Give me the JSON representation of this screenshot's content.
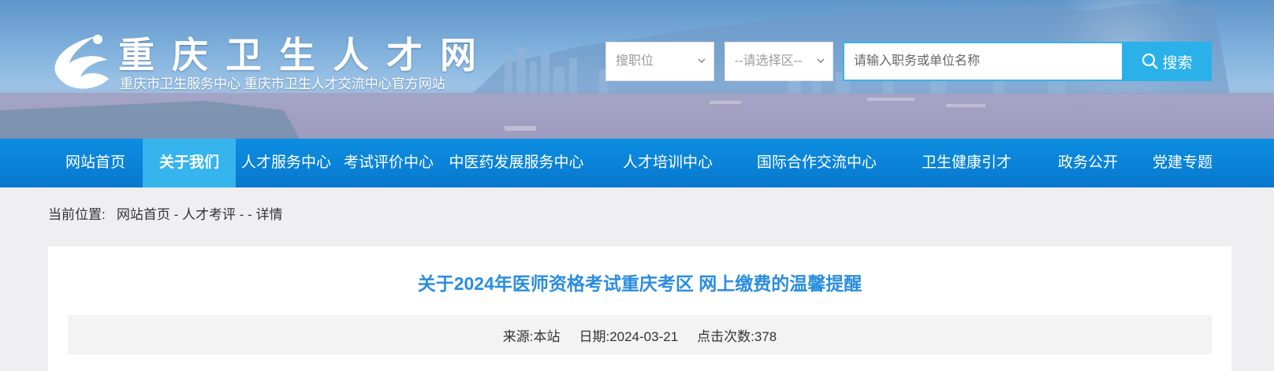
{
  "header": {
    "logo_title": "重庆卫生人才网",
    "logo_subtitle": "重庆市卫生服务中心 重庆市卫生人才交流中心官方网站",
    "job_select": "搜职位",
    "area_select": "--请选择区--",
    "search_placeholder": "请输入职务或单位名称",
    "search_button": "搜索"
  },
  "nav": {
    "items": [
      {
        "label": "网站首页"
      },
      {
        "label": "关于我们"
      },
      {
        "label": "人才服务中心"
      },
      {
        "label": "考试评价中心"
      },
      {
        "label": "中医药发展服务中心"
      },
      {
        "label": "人才培训中心"
      },
      {
        "label": "国际合作交流中心"
      },
      {
        "label": "卫生健康引才"
      },
      {
        "label": "政务公开"
      },
      {
        "label": "党建专题"
      }
    ],
    "active": "关于我们"
  },
  "breadcrumb": {
    "prefix": "当前位置:",
    "path": "网站首页 - 人才考评 - - 详情"
  },
  "article": {
    "title": "关于2024年医师资格考试重庆考区 网上缴费的温馨提醒",
    "source_label": "来源:",
    "source": "本站",
    "date_label": "日期:",
    "date": "2024-03-21",
    "clicks_label": "点击次数:",
    "clicks": "378"
  },
  "colors": {
    "nav_bg": "#0a85d9",
    "nav_active": "#35b4ee",
    "title_blue": "#2b8de0",
    "search_button": "#2ab1ea"
  }
}
